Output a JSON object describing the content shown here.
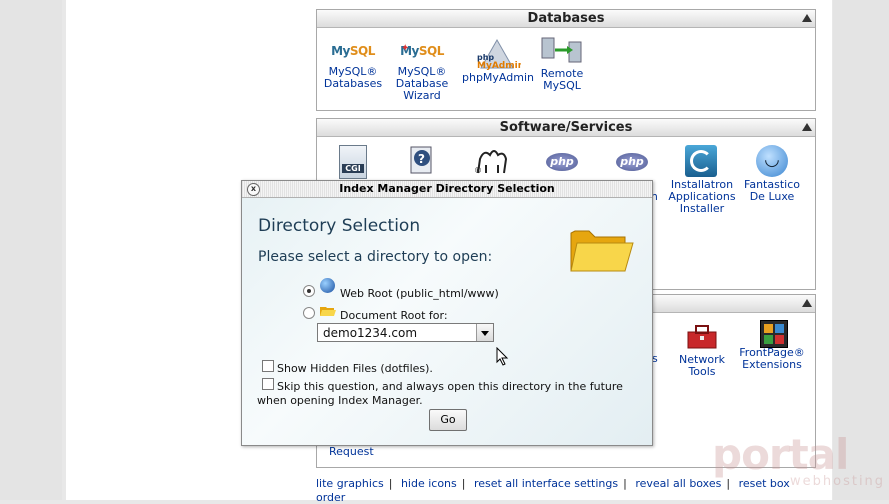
{
  "databases": {
    "title": "Databases",
    "items": [
      {
        "icon": "mysql-icon",
        "label": "MySQL® Databases"
      },
      {
        "icon": "mysql-wizard-icon",
        "label": "MySQL® Database Wizard"
      },
      {
        "icon": "phpmyadmin-icon",
        "label": "phpMyAdmin"
      },
      {
        "icon": "remote-mysql-icon",
        "label": "Remote MySQL"
      }
    ],
    "logo_text": {
      "my": "My",
      "sql": "SQL",
      "php": "php",
      "myadmin": "MyAdmin"
    }
  },
  "software": {
    "title": "Software/Services",
    "items": [
      {
        "icon": "cgi-icon",
        "badge": "CGI"
      },
      {
        "icon": "document-help-icon"
      },
      {
        "icon": "perl-camel-icon"
      },
      {
        "icon": "php-icon",
        "badge": "php"
      },
      {
        "icon": "php-icon",
        "badge": "php",
        "label_partial": "ation"
      },
      {
        "icon": "installatron-icon",
        "label": "Installatron Applications Installer"
      },
      {
        "icon": "fantastico-icon",
        "label": "Fantastico De Luxe"
      }
    ]
  },
  "advanced": {
    "items": [
      {
        "icon": "partial-label",
        "label_partial": "s"
      },
      {
        "icon": "toolbox-icon",
        "label": "Network Tools"
      },
      {
        "icon": "frontpage-icon",
        "label": "FrontPage® Extensions"
      }
    ]
  },
  "behind_dialog": {
    "request_link": "Request"
  },
  "footer": {
    "links": [
      "lite graphics",
      "hide icons",
      "reset all interface settings",
      "reveal all boxes",
      "reset box"
    ],
    "second_line": "order"
  },
  "dialog": {
    "title": "Index Manager Directory Selection",
    "close_glyph": "x",
    "heading": "Directory Selection",
    "prompt": "Please select a directory to open:",
    "option_web_root": "Web Root (public_html/www)",
    "option_document_root": "Document Root for:",
    "selected_option": "web_root",
    "domain_select_value": "demo1234.com",
    "show_hidden_label": "Show Hidden Files (dotfiles).",
    "skip_question_label": "Skip this question, and always open this directory in the future when opening Index Manager.",
    "go_button": "Go"
  },
  "watermark": {
    "main": "portal",
    "sub": "webhosting"
  },
  "colors": {
    "link": "#003399",
    "dialog_heading": "#1e3d55"
  }
}
